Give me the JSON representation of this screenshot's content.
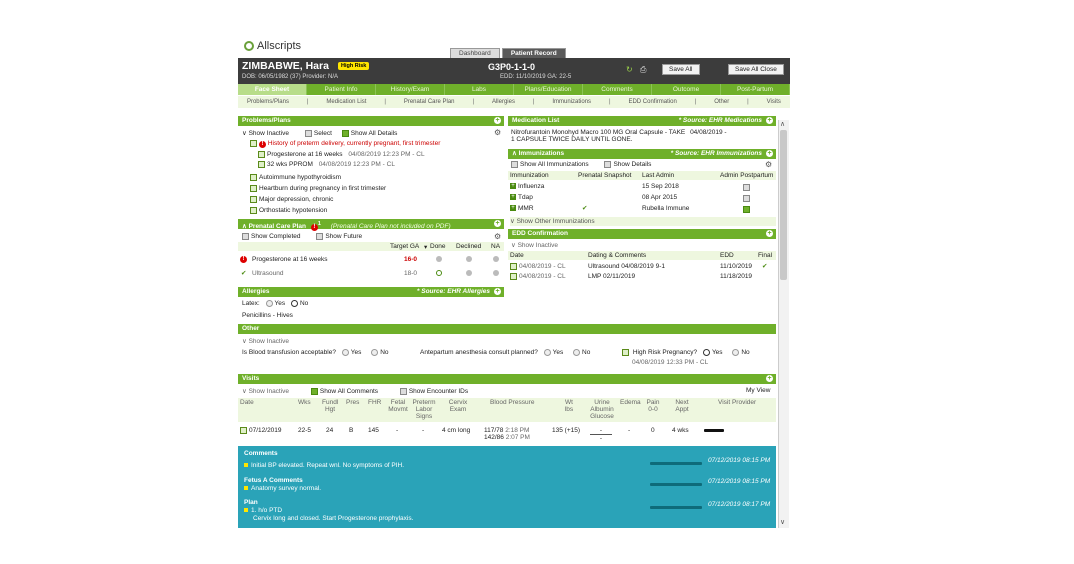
{
  "app": {
    "logo": "Allscripts"
  },
  "top_tabs": [
    "Dashboard",
    "Patient Record"
  ],
  "patient": {
    "name": "ZIMBABWE, Hara",
    "risk": "High Risk",
    "dob_line": "DOB: 06/05/1982 (37)    Provider: N/A",
    "gravida": "G3P0-1-1-0",
    "edd_line": "EDD: 11/10/2019   GA: 22-5"
  },
  "header_buttons": {
    "save_all": "Save All",
    "save_all_close": "Save All Close"
  },
  "nav_tabs": [
    "Face Sheet",
    "Patient Info",
    "History/Exam",
    "Labs",
    "Plans/Education",
    "Comments",
    "Outcome",
    "Post-Partum"
  ],
  "sub_nav": [
    "Problems/Plans",
    "Medication List",
    "Prenatal Care Plan",
    "Allergies",
    "Immunizations",
    "EDD Confirmation",
    "Other",
    "Visits"
  ],
  "problems": {
    "title": "Problems/Plans",
    "show_inactive": "Show Inactive",
    "select": "Select",
    "show_all_details": "Show All Details",
    "history": "History of preterm delivery, currently pregnant, first trimester",
    "sub1": "Progesterone at 16 weeks",
    "sub1_date": "04/08/2019 12:23 PM - CL",
    "sub2": "32 wks PPROM",
    "sub2_date": "04/08/2019 12:23 PM - CL",
    "items": [
      "Autoimmune hypothyroidism",
      "Heartburn during pregnancy in first trimester",
      "Major depression, chronic",
      "Orthostatic hypotension"
    ]
  },
  "prenatal": {
    "title": "Prenatal Care Plan",
    "count": "1",
    "note": "(Prenatal Care Plan not included on PDF)",
    "show_completed": "Show Completed",
    "show_future": "Show Future",
    "cols": [
      "Target GA",
      "Done",
      "Declined",
      "NA"
    ],
    "row1": {
      "name": "Progesterone at 16 weeks",
      "ga": "16-0"
    },
    "row2": {
      "name": "Ultrasound",
      "ga": "18-0"
    }
  },
  "allergies": {
    "title": "Allergies",
    "source": "* Source: EHR Allergies",
    "latex": "Latex:",
    "yes": "Yes",
    "no": "No",
    "item": "Penicillins  - Hives"
  },
  "meds": {
    "title": "Medication List",
    "source": "* Source: EHR Medications",
    "line1": "Nitrofurantoin Monohyd Macro 100 MG Oral Capsule - TAKE",
    "line1_date": "04/08/2019 -",
    "line2": "1 CAPSULE TWICE DAILY UNTIL GONE."
  },
  "immun": {
    "title": "Immunizations",
    "source": "* Source: EHR Immunizations",
    "show_all": "Show All Immunizations",
    "show_details": "Show Details",
    "cols": [
      "Immunization",
      "Prenatal Snapshot",
      "Last Admin",
      "Admin Postpartum"
    ],
    "rows": [
      {
        "name": "Influenza",
        "last": "15 Sep 2018"
      },
      {
        "name": "Tdap",
        "last": "08 Apr 2015"
      },
      {
        "name": "MMR",
        "last": "Rubella Immune"
      }
    ],
    "show_other": "Show Other Immunizations"
  },
  "edd": {
    "title": "EDD Confirmation",
    "show_inactive": "Show Inactive",
    "cols": [
      "Date",
      "Dating & Comments",
      "EDD",
      "Final"
    ],
    "rows": [
      {
        "date": "04/08/2019 - CL",
        "comment": "Ultrasound 04/08/2019 9-1",
        "edd": "11/10/2019"
      },
      {
        "date": "04/08/2019 - CL",
        "comment": "LMP 02/11/2019",
        "edd": "11/18/2019"
      }
    ]
  },
  "other": {
    "title": "Other",
    "show_inactive": "Show Inactive",
    "q1": "Is Blood transfusion acceptable?",
    "q2": "Antepartum anesthesia consult planned?",
    "q3": "High Risk Pregnancy?",
    "q3_date": "04/08/2019 12:33 PM - CL",
    "yes": "Yes",
    "no": "No"
  },
  "visits": {
    "title": "Visits",
    "show_inactive": "Show Inactive",
    "show_all_comments": "Show All Comments",
    "show_encounter": "Show Encounter IDs",
    "my_view": "My View",
    "cols": [
      "Date",
      "Wks",
      "Fundl Hgt",
      "Pres",
      "FHR",
      "Fetal Movmt",
      "Preterm Labor Signs",
      "Cervix Exam",
      "Blood Pressure",
      "Wt lbs",
      "Urine Albumin Glucose",
      "Edema",
      "Pain 0-0",
      "Next Appt",
      "Visit Provider"
    ],
    "row": {
      "date": "07/12/2019",
      "wks": "22-5",
      "fundal": "24",
      "pres": "B",
      "fhr": "145",
      "movmt": "-",
      "ptl": "-",
      "cervix": "4 cm long",
      "bp1": "117/78",
      "bp1_t": "2:18 PM",
      "bp2": "142/86",
      "bp2_t": "2:07 PM",
      "wt": "135 (+15)",
      "urine": "-",
      "urine2": "-",
      "edema": "-",
      "pain": "0",
      "next": "4 wks"
    }
  },
  "comments": {
    "title": "Comments",
    "c1": "Initial BP elevated. Repeat wnl. No symptoms of PIH.",
    "c1_time": "07/12/2019 08:15 PM",
    "fetus_title": "Fetus A Comments",
    "c2": "Anatomy survey normal.",
    "c2_time": "07/12/2019 08:15 PM",
    "plan_title": "Plan",
    "p1": "1. h/o PTD",
    "p2": "Cervix long and closed. Start Progesterone prophylaxis.",
    "p_time": "07/12/2019 08:17 PM"
  }
}
